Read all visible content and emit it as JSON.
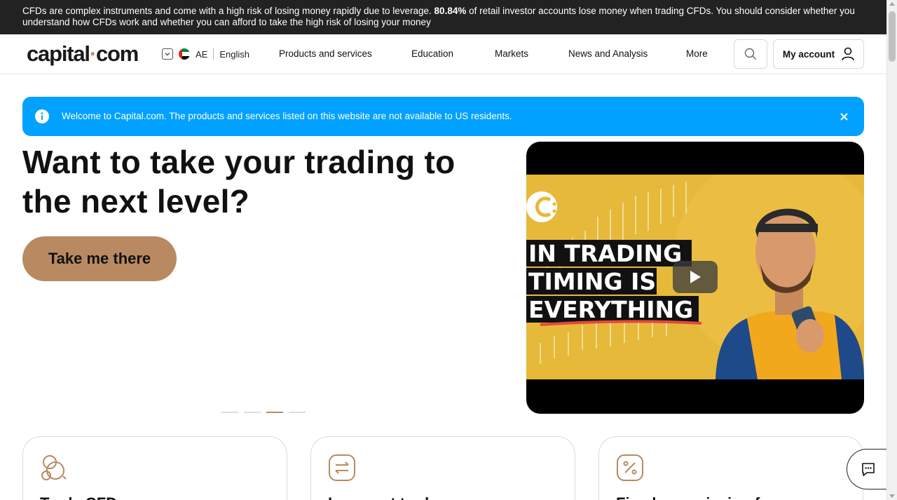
{
  "risk_warning": {
    "before": "CFDs are complex instruments and come with a high risk of losing money rapidly due to leverage.",
    "percent": "80.84%",
    "after": "of retail investor accounts lose money when trading CFDs. You should consider whether you understand how CFDs work and whether you can afford to take the high risk of losing your money"
  },
  "header": {
    "logo_text": "capital",
    "logo_dot": "·",
    "logo_suffix": "com",
    "region_code": "AE",
    "language": "English",
    "nav": [
      "Products and services",
      "Education",
      "Markets",
      "News and Analysis",
      "More"
    ],
    "account_label": "My account"
  },
  "notice": {
    "text": "Welcome to Capital.com. The products and services listed on this website are not available to US residents."
  },
  "hero": {
    "title": "Want to take your trading to the next level?",
    "cta": "Take me there",
    "carousel_total": 4,
    "carousel_active": 3
  },
  "video": {
    "line1": "IN TRADING",
    "line2": "TIMING IS",
    "line3": "EVERYTHING"
  },
  "cards": [
    {
      "title": "Trade CFDs",
      "icon": "coins-icon"
    },
    {
      "title": "Low-cost trades",
      "icon": "exchange-icon"
    },
    {
      "title": "Fixed commission fees",
      "icon": "percent-icon"
    }
  ],
  "colors": {
    "accent": "#b98a62",
    "notice_bg": "#00a1ff",
    "risk_bg": "#222222"
  }
}
